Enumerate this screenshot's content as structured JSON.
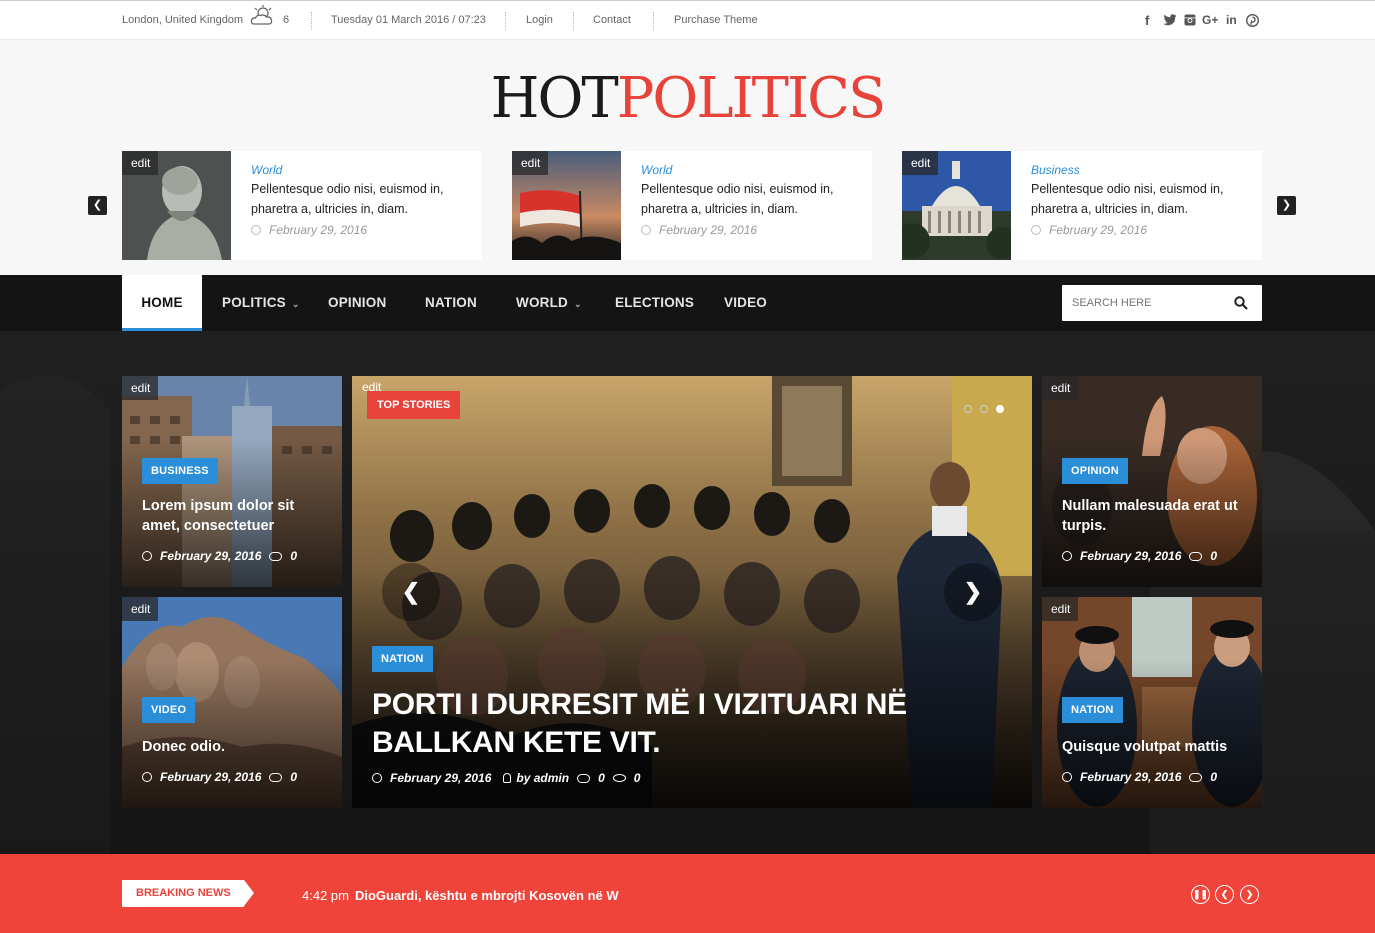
{
  "topbar": {
    "location": "London, United Kingdom",
    "temperature": "6",
    "datetime": "Tuesday 01 March 2016 / 07:23",
    "login": "Login",
    "contact": "Contact",
    "purchase": "Purchase Theme",
    "social": [
      "facebook-icon",
      "twitter-icon",
      "instagram-icon",
      "google-plus-icon",
      "linkedin-icon",
      "pinterest-icon"
    ]
  },
  "logo": {
    "part1": "HOT",
    "part2": "POLITICS"
  },
  "featured": [
    {
      "edit": "edit",
      "category": "World",
      "title": "Pellentesque odio nisi, euismod in, pharetra a, ultricies in, diam.",
      "date": "February 29, 2016"
    },
    {
      "edit": "edit",
      "category": "World",
      "title": "Pellentesque odio nisi, euismod in, pharetra a, ultricies in, diam.",
      "date": "February 29, 2016"
    },
    {
      "edit": "edit",
      "category": "Business",
      "title": "Pellentesque odio nisi, euismod in, pharetra a, ultricies in, diam.",
      "date": "February 29, 2016"
    }
  ],
  "nav": {
    "items": [
      "HOME",
      "POLITICS",
      "OPINION",
      "NATION",
      "WORLD",
      "ELECTIONS",
      "VIDEO"
    ],
    "search_placeholder": "SEARCH HERE"
  },
  "cards": {
    "left_top": {
      "edit": "edit",
      "badge": "BUSINESS",
      "title": "Lorem ipsum dolor sit amet, consectetuer",
      "date": "February 29, 2016",
      "comments": "0"
    },
    "left_bottom": {
      "edit": "edit",
      "badge": "VIDEO",
      "title": "Donec odio.",
      "date": "February 29, 2016",
      "comments": "0"
    },
    "right_top": {
      "edit": "edit",
      "badge": "OPINION",
      "title": "Nullam malesuada erat ut turpis.",
      "date": "February 29, 2016",
      "comments": "0"
    },
    "right_bottom": {
      "edit": "edit",
      "badge": "NATION",
      "title": "Quisque volutpat mattis",
      "date": "February 29, 2016",
      "comments": "0"
    }
  },
  "main_story": {
    "edit": "edit",
    "top_label": "TOP STORIES",
    "badge": "NATION",
    "title": "PORTI I DURRESIT MË I VIZITUARI NË BALLKAN KETE VIT.",
    "date": "February 29, 2016",
    "author": "by admin",
    "comments": "0",
    "views": "0"
  },
  "breaking": {
    "label": "BREAKING NEWS",
    "time": "4:42 pm",
    "text": "DioGuardi, kështu e mbrojti Kosovën në W"
  },
  "colors": {
    "accent": "#e8433a",
    "blue": "#2a8ed9",
    "nav_bg": "#141414"
  }
}
